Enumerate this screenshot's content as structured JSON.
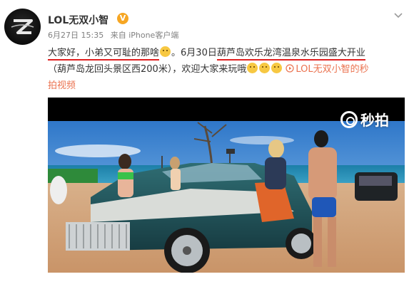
{
  "post": {
    "username": "LOL无双小智",
    "vip_badge": "V",
    "date": "6月27日 15:35",
    "source": "来自 iPhone客户端",
    "text": {
      "l1_a": "大家好，",
      "l1_b": "小弟又可耻的那啥",
      "l1_c": "。6月30日",
      "l1_d": "葫芦岛欢乐龙湾温泉水乐园盛大开业",
      "l2_a": "（葫芦岛龙回头景区西200米），欢迎大家来玩哦",
      "l2_link": "LOL无双小智的秒",
      "l3_link": "拍视频"
    },
    "watermark": "秒拍"
  },
  "colors": {
    "link": "#eb7350",
    "underline": "#e02020",
    "text": "#333333",
    "meta": "#808080"
  },
  "icons": [
    "chevron-down-icon",
    "vip-badge-icon",
    "video-play-icon",
    "miaopai-logo-icon"
  ]
}
